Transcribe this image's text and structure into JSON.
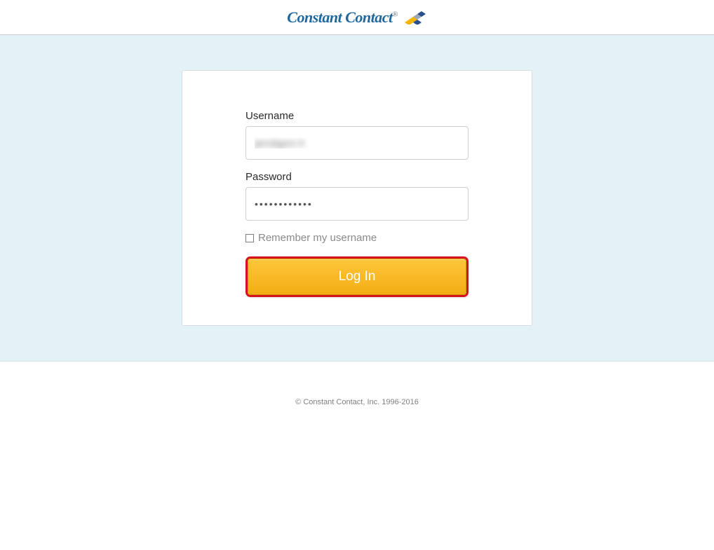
{
  "header": {
    "brand_name": "Constant Contact"
  },
  "login": {
    "username_label": "Username",
    "username_value": "jprodgpro tr",
    "password_label": "Password",
    "password_value": "••••••••••••",
    "remember_label": "Remember my username",
    "button_label": "Log In"
  },
  "footer": {
    "copyright": "© Constant Contact, Inc. 1996-2016"
  }
}
